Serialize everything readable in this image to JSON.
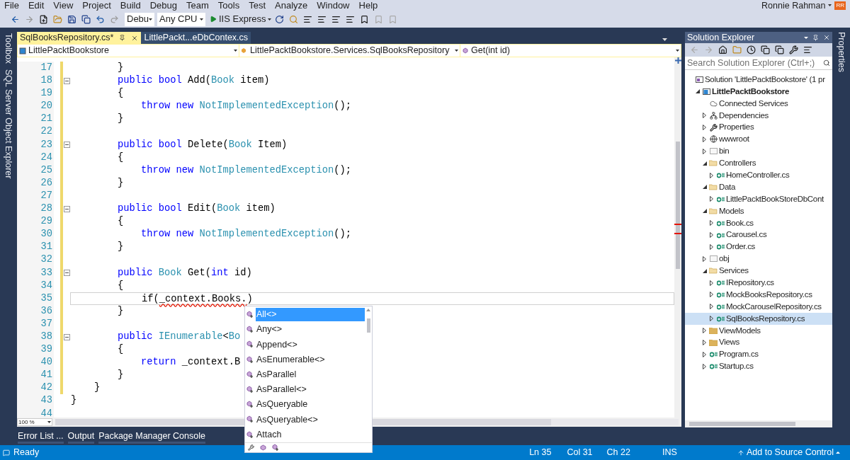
{
  "menu": [
    "File",
    "Edit",
    "View",
    "Project",
    "Build",
    "Debug",
    "Team",
    "Tools",
    "Test",
    "Analyze",
    "Window",
    "Help"
  ],
  "user": {
    "name": "Ronnie Rahman",
    "initials": "RR"
  },
  "toolbar": {
    "configuration": "Debu",
    "platform": "Any CPU",
    "run": "IIS Express"
  },
  "left_tool_tabs": [
    "Toolbox",
    "SQL Server Object Explorer"
  ],
  "right_tool_tabs": [
    "Properties"
  ],
  "editor": {
    "tabs": [
      {
        "label": "SqlBooksRepository.cs*",
        "selected": true
      },
      {
        "label": "LittlePackt...eDbContex.cs",
        "selected": false
      }
    ],
    "navigation": [
      "LittlePacktBookstore",
      "LittlePacktBookstore.Services.SqlBooksRepository",
      "Get(int id)"
    ],
    "lines": [
      {
        "number": "17",
        "changed": true,
        "fold": false,
        "current": false,
        "tokens": [
          {
            "text": "        }",
            "kind": "plain"
          }
        ]
      },
      {
        "number": "18",
        "changed": true,
        "fold": true,
        "current": false,
        "tokens": [
          {
            "text": "        public",
            "kind": "keyword"
          },
          {
            "text": " bool",
            "kind": "keyword"
          },
          {
            "text": " Add(",
            "kind": "plain"
          },
          {
            "text": "Book",
            "kind": "type"
          },
          {
            "text": " item)",
            "kind": "plain"
          }
        ]
      },
      {
        "number": "19",
        "changed": true,
        "fold": false,
        "current": false,
        "tokens": [
          {
            "text": "        {",
            "kind": "plain"
          }
        ]
      },
      {
        "number": "20",
        "changed": true,
        "fold": false,
        "current": false,
        "tokens": [
          {
            "text": "            throw",
            "kind": "keyword"
          },
          {
            "text": " new",
            "kind": "keyword"
          },
          {
            "text": " NotImplementedException",
            "kind": "type"
          },
          {
            "text": "();",
            "kind": "plain"
          }
        ]
      },
      {
        "number": "21",
        "changed": true,
        "fold": false,
        "current": false,
        "tokens": [
          {
            "text": "        }",
            "kind": "plain"
          }
        ]
      },
      {
        "number": "22",
        "changed": true,
        "fold": false,
        "current": false
      },
      {
        "number": "23",
        "changed": true,
        "fold": true,
        "current": false,
        "tokens": [
          {
            "text": "        public",
            "kind": "keyword"
          },
          {
            "text": " bool",
            "kind": "keyword"
          },
          {
            "text": " Delete(",
            "kind": "plain"
          },
          {
            "text": "Book",
            "kind": "type"
          },
          {
            "text": " Item)",
            "kind": "plain"
          }
        ]
      },
      {
        "number": "24",
        "changed": true,
        "fold": false,
        "current": false,
        "tokens": [
          {
            "text": "        {",
            "kind": "plain"
          }
        ]
      },
      {
        "number": "25",
        "changed": true,
        "fold": false,
        "current": false,
        "tokens": [
          {
            "text": "            throw",
            "kind": "keyword"
          },
          {
            "text": " new",
            "kind": "keyword"
          },
          {
            "text": " NotImplementedException",
            "kind": "type"
          },
          {
            "text": "();",
            "kind": "plain"
          }
        ]
      },
      {
        "number": "26",
        "changed": true,
        "fold": false,
        "current": false,
        "tokens": [
          {
            "text": "        }",
            "kind": "plain"
          }
        ]
      },
      {
        "number": "27",
        "changed": true,
        "fold": false,
        "current": false
      },
      {
        "number": "28",
        "changed": true,
        "fold": true,
        "current": false,
        "tokens": [
          {
            "text": "        public",
            "kind": "keyword"
          },
          {
            "text": " bool",
            "kind": "keyword"
          },
          {
            "text": " Edit(",
            "kind": "plain"
          },
          {
            "text": "Book",
            "kind": "type"
          },
          {
            "text": " item)",
            "kind": "plain"
          }
        ]
      },
      {
        "number": "29",
        "changed": true,
        "fold": false,
        "current": false,
        "tokens": [
          {
            "text": "        {",
            "kind": "plain"
          }
        ]
      },
      {
        "number": "30",
        "changed": true,
        "fold": false,
        "current": false,
        "tokens": [
          {
            "text": "            throw",
            "kind": "keyword"
          },
          {
            "text": " new",
            "kind": "keyword"
          },
          {
            "text": " NotImplementedException",
            "kind": "type"
          },
          {
            "text": "();",
            "kind": "plain"
          }
        ]
      },
      {
        "number": "31",
        "changed": true,
        "fold": false,
        "current": false,
        "tokens": [
          {
            "text": "        }",
            "kind": "plain"
          }
        ]
      },
      {
        "number": "32",
        "changed": true,
        "fold": false,
        "current": false
      },
      {
        "number": "33",
        "changed": true,
        "fold": true,
        "current": false,
        "tokens": [
          {
            "text": "        public",
            "kind": "keyword"
          },
          {
            "text": " Book",
            "kind": "type"
          },
          {
            "text": " Get(",
            "kind": "plain"
          },
          {
            "text": "int",
            "kind": "keyword"
          },
          {
            "text": " id)",
            "kind": "plain"
          }
        ]
      },
      {
        "number": "34",
        "changed": true,
        "fold": false,
        "current": false,
        "tokens": [
          {
            "text": "        {",
            "kind": "plain"
          }
        ]
      },
      {
        "number": "35",
        "changed": true,
        "fold": false,
        "current": true,
        "tokens": [
          {
            "text": "            if(",
            "kind": "plain"
          },
          {
            "text": "_context.Books.",
            "kind": "error"
          },
          {
            "text": ")",
            "kind": "plain"
          }
        ]
      },
      {
        "number": "36",
        "changed": true,
        "fold": false,
        "current": false,
        "tokens": [
          {
            "text": "        }",
            "kind": "plain"
          }
        ]
      },
      {
        "number": "37",
        "changed": true,
        "fold": false,
        "current": false
      },
      {
        "number": "38",
        "changed": true,
        "fold": true,
        "current": false,
        "tokens": [
          {
            "text": "        public",
            "kind": "keyword"
          },
          {
            "text": " IEnumerable",
            "kind": "type"
          },
          {
            "text": "<",
            "kind": "plain"
          },
          {
            "text": "Bo",
            "kind": "type"
          }
        ]
      },
      {
        "number": "39",
        "changed": true,
        "fold": false,
        "current": false,
        "tokens": [
          {
            "text": "        {",
            "kind": "plain"
          }
        ]
      },
      {
        "number": "40",
        "changed": true,
        "fold": false,
        "current": false,
        "tokens": [
          {
            "text": "            return",
            "kind": "keyword"
          },
          {
            "text": " _context.B",
            "kind": "plain"
          }
        ]
      },
      {
        "number": "41",
        "changed": true,
        "fold": false,
        "current": false,
        "tokens": [
          {
            "text": "        }",
            "kind": "plain"
          }
        ]
      },
      {
        "number": "42",
        "changed": true,
        "fold": false,
        "current": false,
        "tokens": [
          {
            "text": "    }",
            "kind": "plain"
          }
        ]
      },
      {
        "number": "43",
        "changed": false,
        "fold": false,
        "current": false,
        "tokens": [
          {
            "text": "}",
            "kind": "plain"
          }
        ]
      },
      {
        "number": "44",
        "changed": false,
        "fold": false,
        "current": false
      }
    ],
    "zoom": "100 %",
    "completion": [
      {
        "label": "All<>",
        "selected": true
      },
      {
        "label": "Any<>",
        "selected": false
      },
      {
        "label": "Append<>",
        "selected": false
      },
      {
        "label": "AsEnumerable<>",
        "selected": false
      },
      {
        "label": "AsParallel",
        "selected": false
      },
      {
        "label": "AsParallel<>",
        "selected": false
      },
      {
        "label": "AsQueryable",
        "selected": false
      },
      {
        "label": "AsQueryable<>",
        "selected": false
      },
      {
        "label": "Attach",
        "selected": false
      }
    ]
  },
  "solution_explorer": {
    "title": "Solution Explorer",
    "search": {
      "placeholder": "Search Solution Explorer (Ctrl+;)"
    },
    "tree": [
      {
        "label": "Solution 'LittlePacktBookstore' (1 pr",
        "kind": "solution",
        "selected": false,
        "children": [
          {
            "label": "LittlePacktBookstore",
            "kind": "project",
            "expanded": true,
            "selected": false,
            "children": [
              {
                "label": "Connected Services",
                "kind": "connected",
                "selected": false
              },
              {
                "label": "Dependencies",
                "kind": "dependencies",
                "expanded": false,
                "selected": false
              },
              {
                "label": "Properties",
                "kind": "properties",
                "expanded": false,
                "selected": false
              },
              {
                "label": "wwwroot",
                "kind": "web",
                "expanded": false,
                "selected": false
              },
              {
                "label": "bin",
                "kind": "hidden-folder",
                "expanded": false,
                "selected": false
              },
              {
                "label": "Controllers",
                "kind": "folder",
                "expanded": true,
                "selected": false,
                "children": [
                  {
                    "label": "HomeController.cs",
                    "kind": "csharp",
                    "expanded": false,
                    "selected": false
                  }
                ]
              },
              {
                "label": "Data",
                "kind": "folder",
                "expanded": true,
                "selected": false,
                "children": [
                  {
                    "label": "LittlePacktBookStoreDbCont",
                    "kind": "csharp",
                    "expanded": false,
                    "selected": false
                  }
                ]
              },
              {
                "label": "Models",
                "kind": "folder",
                "expanded": true,
                "selected": false,
                "children": [
                  {
                    "label": "Book.cs",
                    "kind": "csharp",
                    "expanded": false,
                    "selected": false
                  },
                  {
                    "label": "Carousel.cs",
                    "kind": "csharp",
                    "expanded": false,
                    "selected": false
                  },
                  {
                    "label": "Order.cs",
                    "kind": "csharp",
                    "expanded": false,
                    "selected": false
                  }
                ]
              },
              {
                "label": "obj",
                "kind": "hidden-folder",
                "expanded": false,
                "selected": false
              },
              {
                "label": "Services",
                "kind": "folder",
                "expanded": true,
                "selected": false,
                "children": [
                  {
                    "label": "IRepository.cs",
                    "kind": "csharp",
                    "expanded": false,
                    "selected": false
                  },
                  {
                    "label": "MockBooksRepository.cs",
                    "kind": "csharp",
                    "expanded": false,
                    "selected": false
                  },
                  {
                    "label": "MockCarouselRepository.cs",
                    "kind": "csharp",
                    "expanded": false,
                    "selected": false
                  },
                  {
                    "label": "SqlBooksRepository.cs",
                    "kind": "csharp",
                    "expanded": false,
                    "selected": true
                  }
                ]
              },
              {
                "label": "ViewModels",
                "kind": "folder",
                "expanded": false,
                "selected": false
              },
              {
                "label": "Views",
                "kind": "folder",
                "expanded": false,
                "selected": false
              },
              {
                "label": "Program.cs",
                "kind": "csharp",
                "expanded": false,
                "selected": false
              },
              {
                "label": "Startup.cs",
                "kind": "csharp",
                "expanded": false,
                "selected": false
              }
            ]
          }
        ]
      }
    ]
  },
  "output_tabs": [
    "Error List ...",
    "Output",
    "Package Manager Console"
  ],
  "status_bar": {
    "message": "Ready",
    "line": "Ln 35",
    "column": "Col 31",
    "char": "Ch 22",
    "mode": "INS",
    "source_control": "Add to Source Control"
  }
}
